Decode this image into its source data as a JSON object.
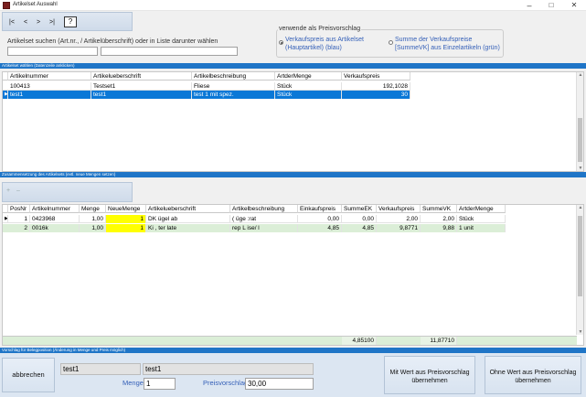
{
  "window": {
    "title": "Artikelset Auswahl",
    "minimize": "–",
    "maximize": "□",
    "close": "✕"
  },
  "toolbar": {
    "first": "|<",
    "prev": "<",
    "next": ">",
    "last": ">|",
    "help": "?"
  },
  "search": {
    "label": "Artikelset suchen (Art.nr., / Artikelüberschrift) oder in Liste darunter wählen",
    "value1": "",
    "value2": ""
  },
  "price_source": {
    "legend": "verwende als Preisvorschlag",
    "option1_line1": "Verkaufspreis aus Artikelset",
    "option1_line2": "(Hauptartikel) (blau)",
    "option2_line1": "Summe der Verkaufspreise",
    "option2_line2": "[SummeVK] aus Einzelartikeln (grün)",
    "selected": "option1"
  },
  "section1": {
    "title": "Artikelset wählen (Datenzeile anklicken)"
  },
  "sets": {
    "columns": [
      "Artikelnummer",
      "Artikelueberschrift",
      "Artikelbeschreibung",
      "ArtderMenge",
      "Verkaufspreis"
    ],
    "rows": [
      {
        "c0": "100413",
        "c1": "Testset1",
        "c2": "Fliese",
        "c3": "Stück",
        "c4": "192,1028"
      },
      {
        "c0": "test1",
        "c1": "test1",
        "c2": "test 1 mit spez.",
        "c3": "Stück",
        "c4": "30"
      }
    ]
  },
  "section2": {
    "title": "Zusammensetzung des Artikelsets (evtl. neue Mengen setzen)",
    "add": "+",
    "remove": "–"
  },
  "components": {
    "columns": [
      "PosNr",
      "Artikelnummer",
      "Menge",
      "NeueMenge",
      "Artikelueberschrift",
      "Artikelbeschreibung",
      "Einkaufspreis",
      "SummeEK",
      "Verkaufspreis",
      "SummeVK",
      "ArtderMenge"
    ],
    "rows": [
      {
        "c0": "1",
        "c1": "0423968",
        "c2": "1,00",
        "c3": "1",
        "c4": "DK   ügel       ab",
        "c5": "(       üge       :rat",
        "c6": "0,00",
        "c7": "0,00",
        "c8": "2,00",
        "c9": "2,00",
        "c10": "Stück"
      },
      {
        "c0": "2",
        "c1": "0016k",
        "c2": "1,00",
        "c3": "1",
        "c4": "Ki      ,     ter       late",
        "c5": "rep  L       ise/  l",
        "c6": "4,85",
        "c7": "4,85",
        "c8": "9,8771",
        "c9": "9,88",
        "c10": "1 unit"
      }
    ],
    "sum_ek": "4,85100",
    "sum_vk": "11,87710"
  },
  "section3": {
    "title": "Vorschlag für Belegposition (Änderung in Menge und Preis möglich)"
  },
  "bottom": {
    "cancel": "abbrechen",
    "artnr": "test1",
    "name": "test1",
    "menge_label": "Menge",
    "menge_value": "1",
    "preis_label": "Preisvorschlag",
    "preis_value": "30,00",
    "with_value_line1": "Mit Wert aus Preisvorschlag",
    "with_value_line2": "übernehmen",
    "without_value_line1": "Ohne Wert aus Preisvorschlag",
    "without_value_line2": "übernehmen"
  },
  "colors": {
    "accent": "#1f75c7",
    "selected_row": "#0a78d7",
    "green_row": "#dbeed7",
    "yellow_cell": "#ffff00",
    "label_blue": "#3560b8"
  }
}
